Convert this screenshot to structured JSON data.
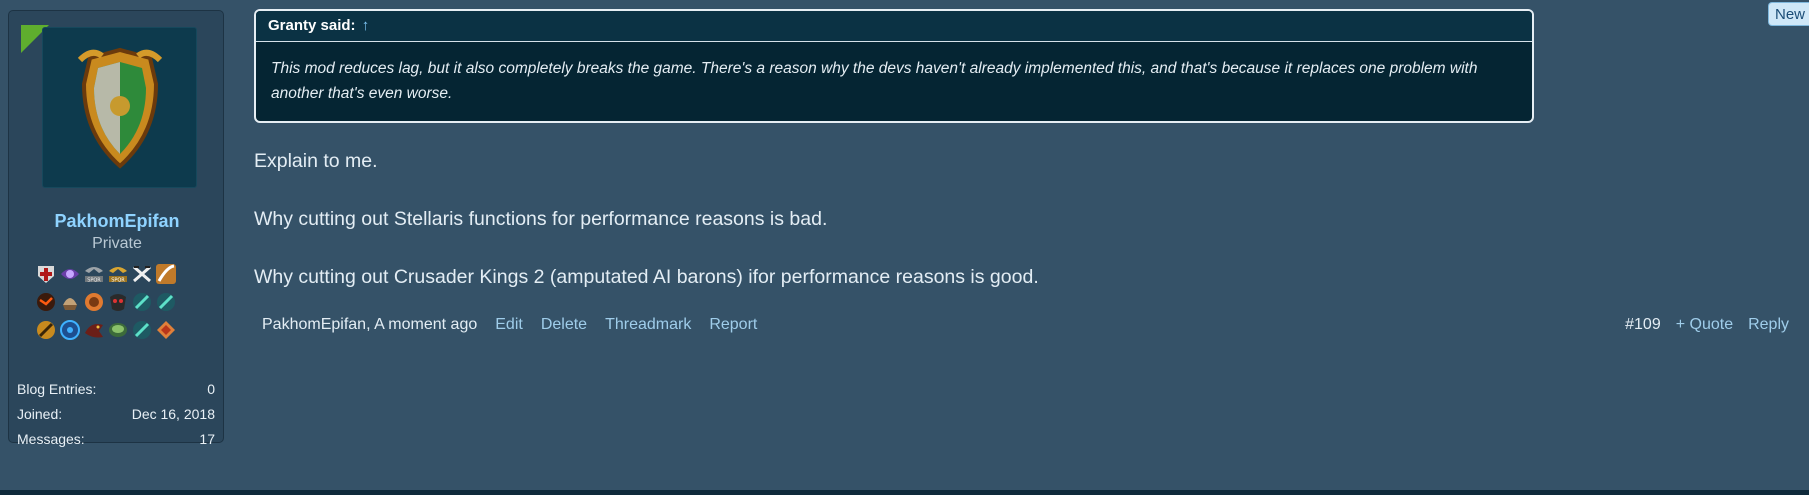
{
  "sidebar": {
    "username": "PakhomEpifan",
    "user_title": "Private",
    "avatar_icon": "heraldic-shield-icon",
    "trophies": [
      "templar-cross-icon",
      "purple-eye-icon",
      "spqr-eagle-icon",
      "spqr-gold-eagle-icon",
      "crossed-swords-icon",
      "sabre-icon",
      "blank-icon",
      "lava-rock-icon",
      "horn-helmet-icon",
      "fire-orb-icon",
      "dark-mask-icon",
      "green-blade-icon",
      "green-blade-icon",
      "blank-icon",
      "golden-sword-icon",
      "blue-gear-icon",
      "dragon-icon",
      "green-disc-icon",
      "green-blade-icon",
      "orange-diamond-icon",
      "blank-icon"
    ],
    "stats": [
      {
        "label": "Blog Entries:",
        "value": "0"
      },
      {
        "label": "Joined:",
        "value": "Dec 16, 2018"
      },
      {
        "label": "Messages:",
        "value": "17"
      }
    ]
  },
  "quote": {
    "author": "Granty said:",
    "arrow": "↑",
    "text": "This mod reduces lag, but it also completely breaks the game. There's a reason why the devs haven't already implemented this, and that's because it replaces one problem with another that's even worse."
  },
  "message": {
    "lines": [
      "Explain to me.",
      "Why cutting out Stellaris functions for performance reasons is bad.",
      "Why cutting out Crusader Kings 2 (amputated AI barons) ifor performance reasons is good."
    ]
  },
  "footer": {
    "author_time": "PakhomEpifan, A moment ago",
    "edit": "Edit",
    "delete": "Delete",
    "threadmark": "Threadmark",
    "report": "Report",
    "post_number": "#109",
    "quote": "+ Quote",
    "reply": "Reply"
  },
  "badge": {
    "new_label": "New"
  },
  "colors": {
    "accent": "#8fd3ff",
    "background": "#355268",
    "new_corner": "#5fae2e"
  }
}
